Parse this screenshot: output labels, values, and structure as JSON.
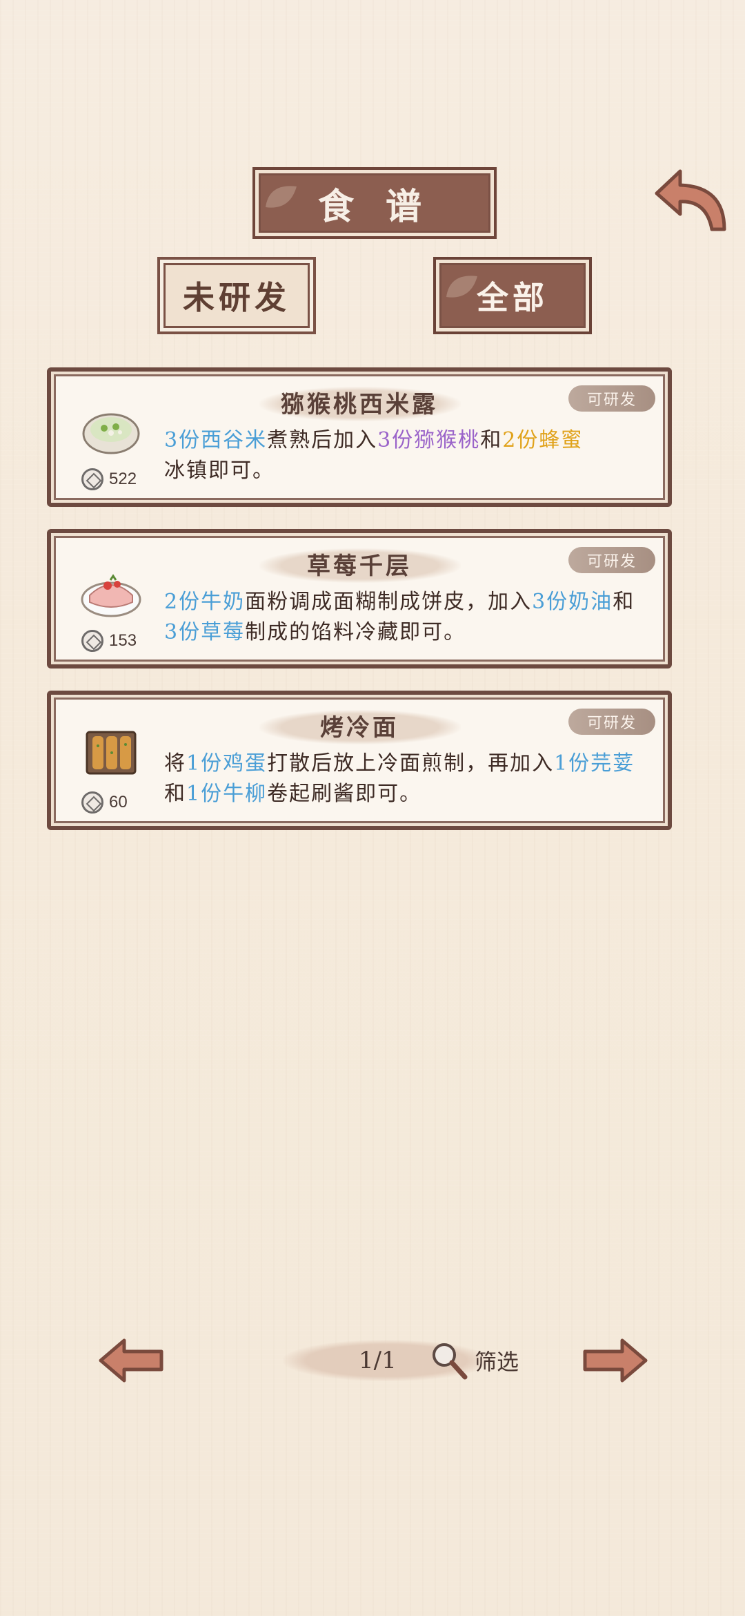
{
  "header": {
    "title": "食 谱",
    "tabs": [
      {
        "label": "未研发"
      },
      {
        "label": "全部"
      }
    ]
  },
  "recipes": [
    {
      "name": "猕猴桃西米露",
      "status": "可研发",
      "cost": "522",
      "desc_parts": [
        "3份西谷米",
        "煮熟后加入",
        "3份猕猴桃",
        "和",
        "2份蜂蜜",
        "冰镇即可。"
      ]
    },
    {
      "name": "草莓千层",
      "status": "可研发",
      "cost": "153",
      "desc_parts": [
        "2份牛奶",
        "面粉调成面糊制成饼皮，加入",
        "3份奶油",
        "和",
        "3份草莓",
        "制成的馅料冷藏即可。"
      ]
    },
    {
      "name": "烤冷面",
      "status": "可研发",
      "cost": "60",
      "desc_parts": [
        "将",
        "1份鸡蛋",
        "打散后放上冷面煎制，再加入",
        "1份芫荽",
        "和",
        "1份牛柳",
        "卷起刷酱即可。"
      ]
    }
  ],
  "footer": {
    "page": "1/1",
    "filter_label": "筛选"
  },
  "colors": {
    "plaque": "#8c5e50",
    "border": "#6d4a40",
    "highlight_blue": "#4a9ed6",
    "highlight_purple": "#9a63c9",
    "highlight_gold": "#e0a21a"
  },
  "icons": [
    "back-arrow-icon",
    "coin-icon",
    "magnifier-icon",
    "left-arrow-icon",
    "right-arrow-icon"
  ]
}
